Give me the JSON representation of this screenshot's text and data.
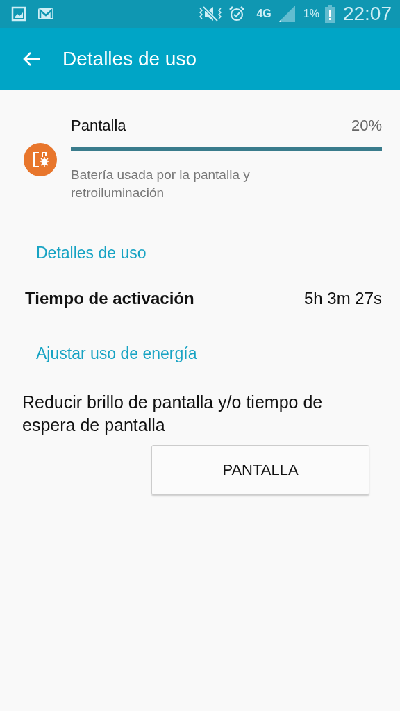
{
  "status_bar": {
    "battery_text": "1%",
    "time": "22:07",
    "network": "4G"
  },
  "app_bar": {
    "title": "Detalles de uso"
  },
  "usage_item": {
    "name": "Pantalla",
    "percent": "20%",
    "level": 1,
    "description": "Batería usada por la pantalla y retroiluminación"
  },
  "sections": [
    {
      "kind": "header",
      "text": "Detalles de uso"
    },
    {
      "kind": "stat",
      "label": "Tiempo de activación",
      "value": "5h 3m 27s"
    },
    {
      "kind": "header",
      "text": "Ajustar uso de energía"
    },
    {
      "kind": "tip",
      "text": "Reducir brillo de pantalla y/o tiempo de espera de pantalla",
      "button": "PANTALLA"
    }
  ]
}
